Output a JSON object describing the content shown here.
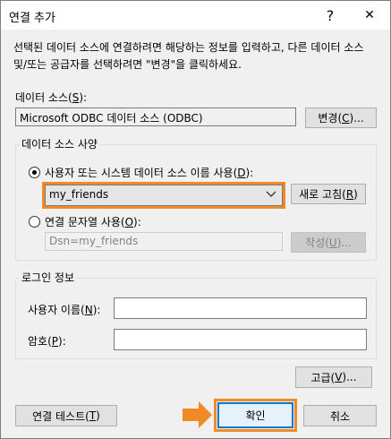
{
  "window": {
    "title": "연결 추가",
    "help_glyph": "?",
    "close_glyph": "✕"
  },
  "intro": "선택된 데이터 소스에 연결하려면 해당하는 정보를 입력하고, 다른 데이터 소스 및/또는 공급자를 선택하려면 \"변경\"을 클릭하세요.",
  "datasource": {
    "label_prefix": "데이터 소스(",
    "label_key": "S",
    "label_suffix": "):",
    "value": "Microsoft ODBC 데이터 소스 (ODBC)",
    "change_prefix": "변경(",
    "change_key": "C",
    "change_suffix": ")..."
  },
  "spec_group": {
    "title": "데이터 소스 사양",
    "use_dsn": {
      "label_prefix": "사용자 또는 시스템 데이터 소스 이름 사용(",
      "label_key": "D",
      "label_suffix": "):",
      "selected": "my_friends",
      "refresh_prefix": "새로 고침(",
      "refresh_key": "R",
      "refresh_suffix": ")"
    },
    "use_conn_string": {
      "label_prefix": "연결 문자열 사용(",
      "label_key": "O",
      "label_suffix": "):",
      "value": "Dsn=my_friends",
      "build_prefix": "작성(",
      "build_key": "U",
      "build_suffix": ")..."
    }
  },
  "login_group": {
    "title": "로그인 정보",
    "user_prefix": "사용자 이름(",
    "user_key": "N",
    "user_suffix": "):",
    "password_prefix": "암호(",
    "password_key": "P",
    "password_suffix": "):"
  },
  "buttons": {
    "advanced_prefix": "고급(",
    "advanced_key": "V",
    "advanced_suffix": ")...",
    "test_prefix": "연결 테스트(",
    "test_key": "T",
    "test_suffix": ")",
    "ok": "확인",
    "cancel": "취소"
  },
  "colors": {
    "highlight": "#f08a24"
  },
  "icons": {
    "pointer": "orange-arrow-icon"
  }
}
